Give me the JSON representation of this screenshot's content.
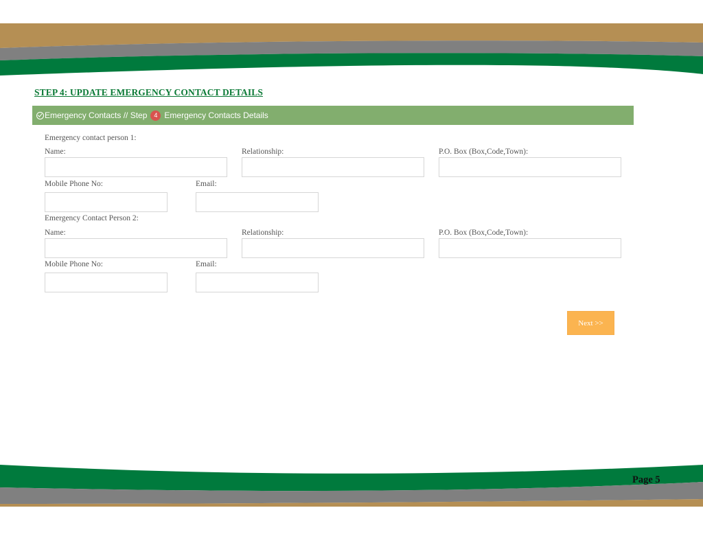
{
  "colors": {
    "gold_band": "#b58f54",
    "gray_band": "#808080",
    "green_band": "#007a3d",
    "header_green": "#82ae6e",
    "title_green": "#0b7a36",
    "badge_red": "#d9534f",
    "next_orange": "#fbb450"
  },
  "step_title": "STEP 4: UPDATE EMERGENCY CONTACT DETAILS",
  "panel": {
    "breadcrumb": "Emergency Contacts // Step",
    "step_number": "4",
    "section_title": "Emergency Contacts Details"
  },
  "person1": {
    "heading": "Emergency contact person 1:",
    "name_label": "Name:",
    "relationship_label": "Relationship:",
    "pobox_label": "P.O. Box (Box,Code,Town):",
    "mobile_label": "Mobile Phone No:",
    "email_label": "Email:"
  },
  "person2": {
    "heading": "Emergency Contact Person 2:",
    "name_label": "Name:",
    "relationship_label": "Relationship:",
    "pobox_label": "P.O. Box (Box,Code,Town):",
    "mobile_label": "Mobile Phone No:",
    "email_label": "Email:"
  },
  "next_button": "Next >>",
  "page_number": "Page 5"
}
